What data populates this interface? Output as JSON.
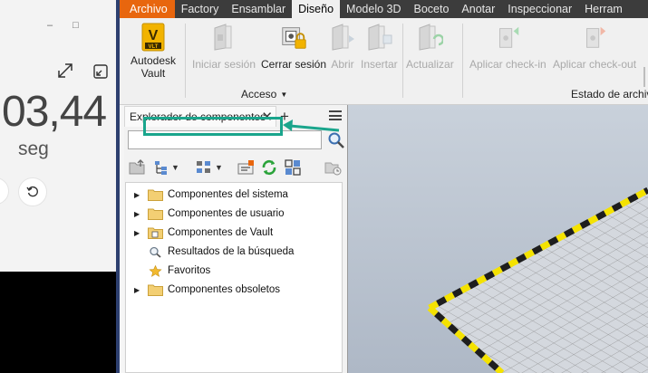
{
  "stopwatch": {
    "time_display": "03,44",
    "unit_label": "seg",
    "window_buttons": [
      "–",
      "□"
    ]
  },
  "menu": {
    "tabs": [
      {
        "label": "Archivo",
        "kind": "file"
      },
      {
        "label": "Factory",
        "kind": "normal"
      },
      {
        "label": "Ensamblar",
        "kind": "normal"
      },
      {
        "label": "Diseño",
        "kind": "active"
      },
      {
        "label": "Modelo 3D",
        "kind": "normal"
      },
      {
        "label": "Boceto",
        "kind": "normal"
      },
      {
        "label": "Anotar",
        "kind": "normal"
      },
      {
        "label": "Inspeccionar",
        "kind": "normal"
      },
      {
        "label": "Herram",
        "kind": "normal"
      }
    ]
  },
  "ribbon": {
    "vault_line1": "Autodesk",
    "vault_line2": "Vault",
    "vault_logo": "V",
    "vault_logo_sub": "VLT",
    "login": "Iniciar sesión",
    "logout": "Cerrar sesión",
    "open": "Abrir",
    "insert": "Insertar",
    "update": "Actualizar",
    "checkin": "Aplicar check-in",
    "checkout": "Aplicar check-out",
    "group_access": "Acceso",
    "group_file_state": "Estado de archivo"
  },
  "browser": {
    "tab_label": "Explorador de componentes",
    "close_glyph": "✕",
    "add_glyph": "+",
    "search_placeholder": "",
    "tree": [
      {
        "label": "Componentes del sistema",
        "icon": "folder-icon",
        "expandable": true
      },
      {
        "label": "Componentes de usuario",
        "icon": "folder-icon",
        "expandable": true
      },
      {
        "label": "Componentes de Vault",
        "icon": "vault-folder-icon",
        "expandable": true
      },
      {
        "label": "Resultados de la búsqueda",
        "icon": "search-results-icon",
        "expandable": false
      },
      {
        "label": "Favoritos",
        "icon": "star-icon",
        "expandable": false
      },
      {
        "label": "Componentes obsoletos",
        "icon": "folder-icon",
        "expandable": true
      }
    ]
  },
  "colors": {
    "file_tab": "#e8660e",
    "highlight": "#1aa58c",
    "hazard_yellow": "#f4e200",
    "hazard_black": "#1e1e1e",
    "grid_line": "#8a8a8a",
    "floor": "#d4d8de"
  }
}
